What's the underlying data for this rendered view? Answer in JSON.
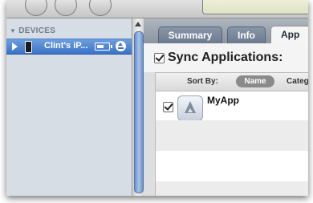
{
  "sidebar": {
    "section_header": "DEVICES",
    "device": {
      "name": "Clint's iP..."
    }
  },
  "tabs": [
    {
      "label": "Summary",
      "active": false
    },
    {
      "label": "Info",
      "active": false
    },
    {
      "label": "App",
      "active": true
    }
  ],
  "sync": {
    "label": "Sync Applications:",
    "checked": true
  },
  "sort": {
    "label": "Sort By:",
    "options": [
      "Name",
      "Categ"
    ],
    "selected": "Name"
  },
  "apps": [
    {
      "name": "MyApp",
      "checked": true,
      "icon": "app-store-icon"
    }
  ],
  "colors": {
    "sidebar_bg": "#d6dde5",
    "selection": "#3a73c8",
    "tab_bar": "#8b949f"
  }
}
